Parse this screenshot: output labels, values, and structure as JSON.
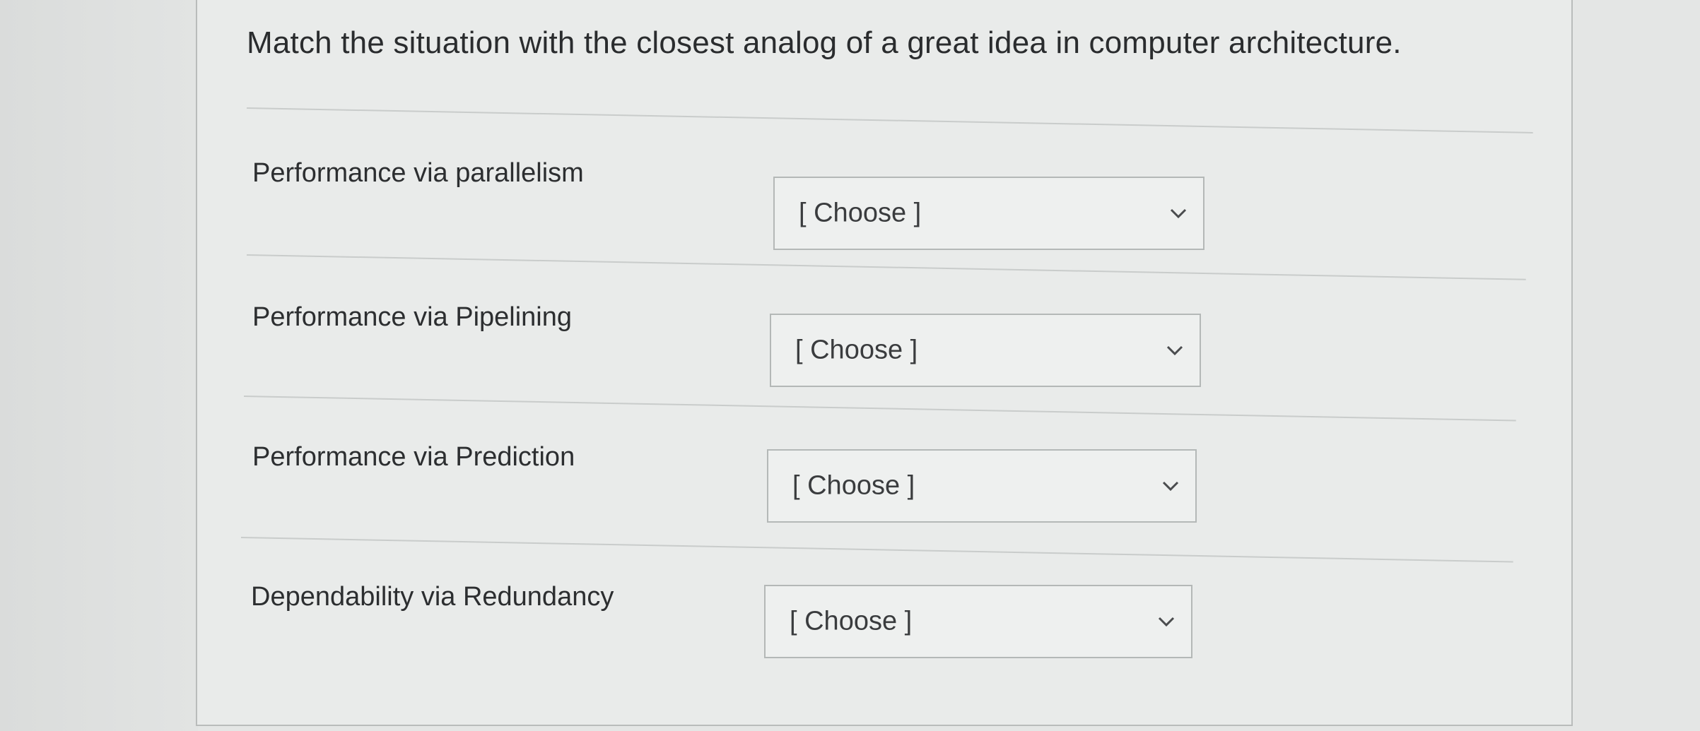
{
  "prompt": "Match the situation with the closest analog of a great idea in computer architecture.",
  "rows": [
    {
      "label": "Performance via parallelism",
      "selected": "[ Choose ]"
    },
    {
      "label": "Performance via Pipelining",
      "selected": "[ Choose ]"
    },
    {
      "label": "Performance via Prediction",
      "selected": "[ Choose ]"
    },
    {
      "label": "Dependability via Redundancy",
      "selected": "[ Choose ]"
    }
  ],
  "icons": {
    "dropdown": "chevron-down-icon"
  }
}
